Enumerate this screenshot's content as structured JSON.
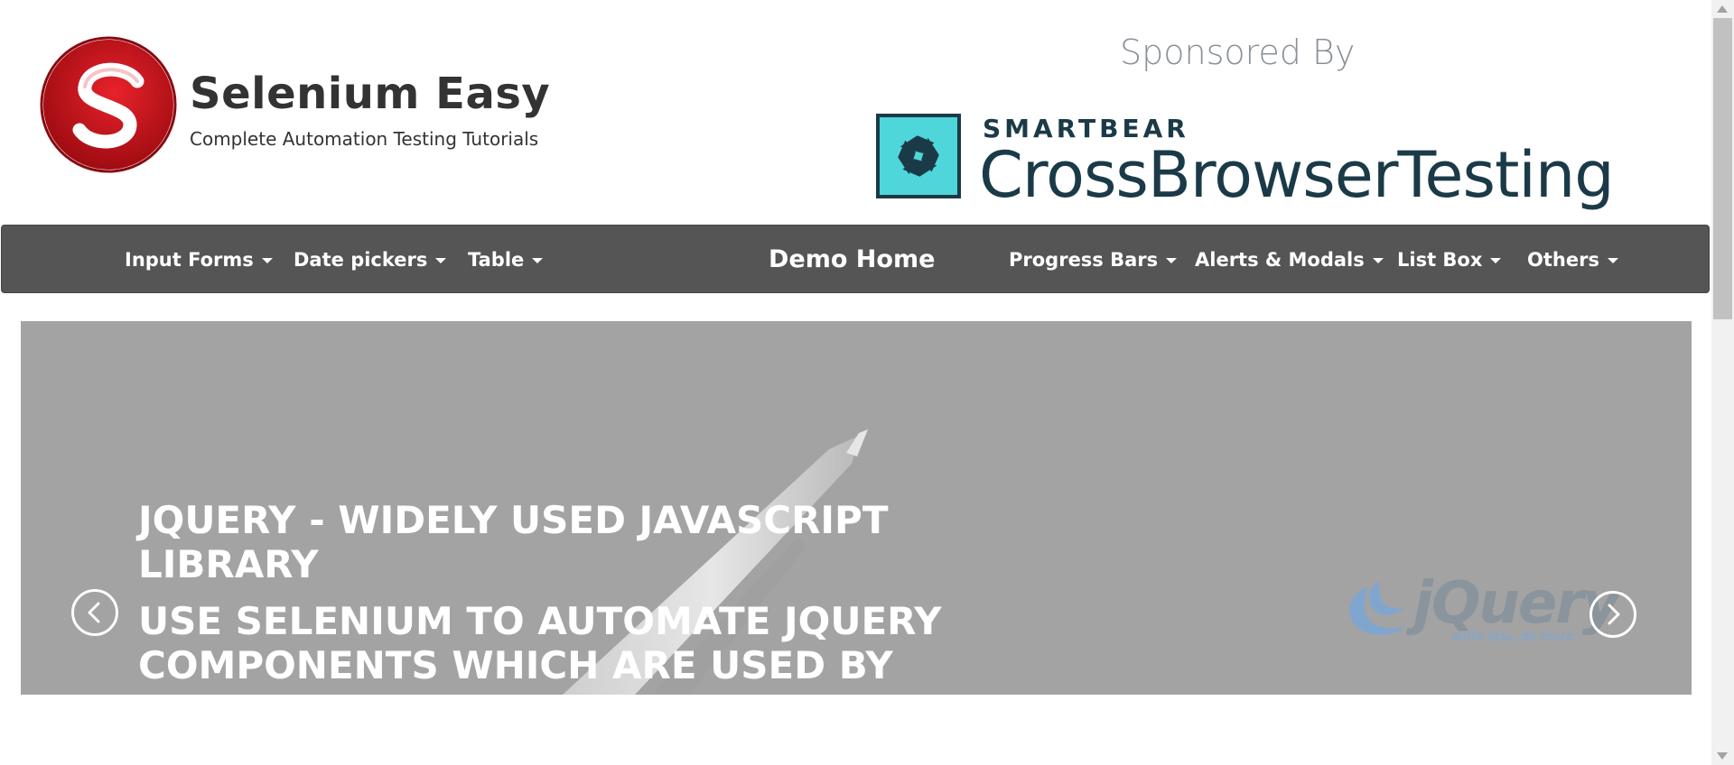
{
  "header": {
    "brand_title": "Selenium Easy",
    "brand_subtitle": "Complete Automation Testing Tutorials",
    "sponsored_label": "Sponsored By",
    "sponsor_smartbear": "SMARTBEAR",
    "sponsor_product": "CrossBrowserTesting"
  },
  "nav": {
    "input_forms": "Input Forms",
    "date_pickers": "Date pickers",
    "table": "Table",
    "demo_home": "Demo Home",
    "progress_bars": "Progress Bars",
    "alerts_modals": "Alerts & Modals",
    "list_box": "List Box",
    "others": "Others"
  },
  "carousel": {
    "title": "JQUERY - WIDELY USED JAVASCRIPT LIBRARY",
    "body": "USE SELENIUM TO AUTOMATE JQUERY COMPONENTS WHICH ARE USED BY",
    "jquery_word": "jQuery",
    "jquery_tagline": "write less, do more."
  },
  "colors": {
    "navbar_bg": "#555555",
    "logo_red": "#c0121b",
    "sponsor_teal": "#4fd6da",
    "sponsor_navy": "#1b3a48",
    "carousel_bg": "#a3a3a3"
  },
  "icons": {
    "logo": "selenium-easy-logo-icon",
    "sponsor": "crossbrowsertesting-logo-icon",
    "prev": "chevron-left-icon",
    "next": "chevron-right-icon",
    "caret": "caret-down-icon",
    "jquery": "jquery-logo-icon"
  }
}
